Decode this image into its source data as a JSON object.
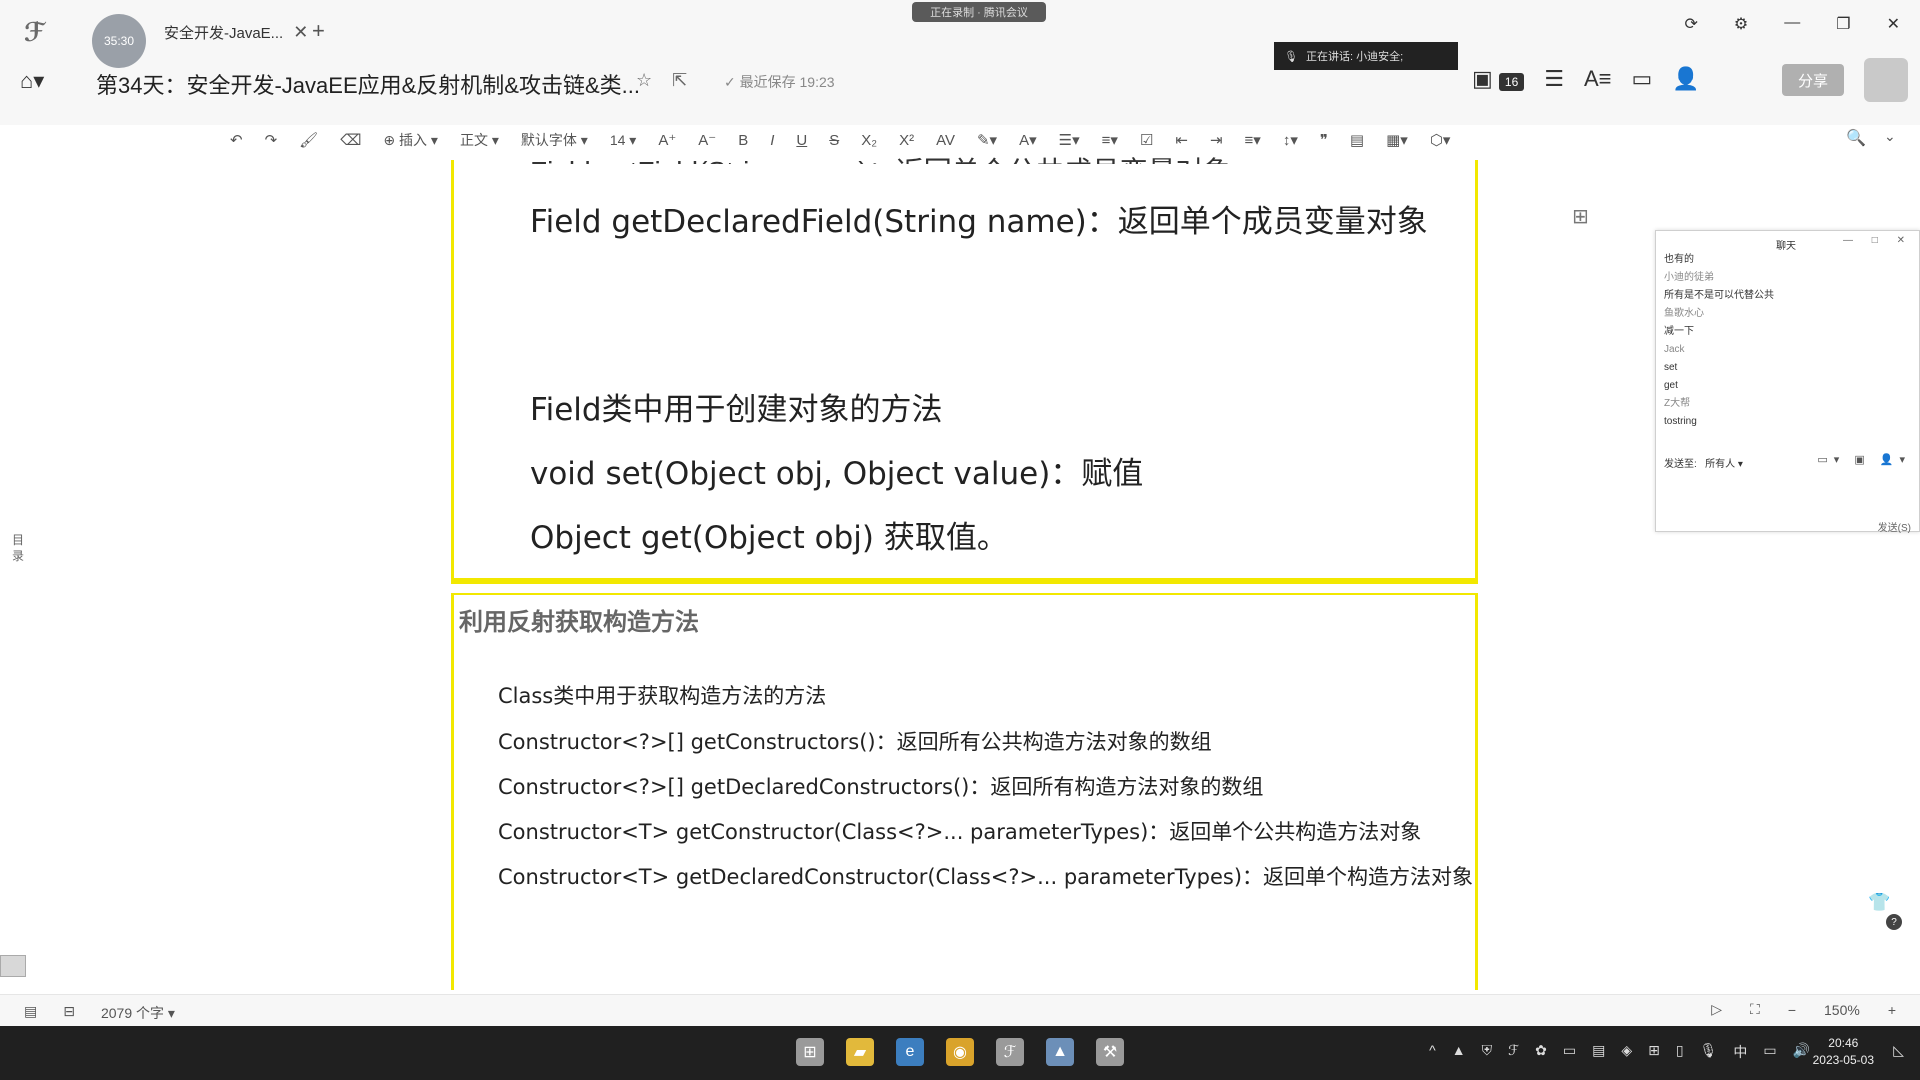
{
  "tab": {
    "timer": "35:30",
    "title": "安全开发-JavaE...",
    "close": "✕",
    "add": "+"
  },
  "header": {
    "doc_title": "第34天：安全开发-JavaEE应用&反射机制&攻击链&类...",
    "last_edit": "最近保存 19:23",
    "recording": "正在录制 · 腾讯会议",
    "speaking": "正在讲话: 小迪安全;",
    "participant_count": "16",
    "share": "分享"
  },
  "toolbar": {
    "insert": "插入",
    "style": "正文",
    "font": "默认字体",
    "size": "14"
  },
  "doc": {
    "cut_line": "Field getField(String name)：返回单个公共成员变量对象",
    "field_declared": "Field getDeclaredField(String name)：返回单个成员变量对象",
    "field_create_heading": "Field类中用于创建对象的方法",
    "set_line": "void set(Object obj, Object value)：赋值",
    "get_line": "Object get(Object obj) 获取值。",
    "section_heading": "利用反射获取构造方法",
    "ctor_heading": "Class类中用于获取构造方法的方法",
    "ctor_lines": [
      "Constructor<?>[] getConstructors()：返回所有公共构造方法对象的数组",
      "Constructor<?>[] getDeclaredConstructors()：返回所有构造方法对象的数组",
      "Constructor<T> getConstructor(Class<?>... parameterTypes)：返回单个公共构造方法对象",
      "Constructor<T> getDeclaredConstructor(Class<?>... parameterTypes)：返回单个构造方法对象"
    ]
  },
  "sidebar": {
    "toc": "目录"
  },
  "chat": {
    "title": "聊天",
    "messages": [
      {
        "text": "也有的",
        "kind": "msg"
      },
      {
        "text": "小迪的徒弟",
        "kind": "name"
      },
      {
        "text": "所有是不是可以代替公共",
        "kind": "msg"
      },
      {
        "text": "鱼歌水心",
        "kind": "name"
      },
      {
        "text": "减一下",
        "kind": "msg"
      },
      {
        "text": "Jack",
        "kind": "name"
      },
      {
        "text": "set",
        "kind": "msg"
      },
      {
        "text": "get",
        "kind": "msg"
      },
      {
        "text": "Z大帮",
        "kind": "name"
      },
      {
        "text": "tostring",
        "kind": "msg"
      }
    ],
    "send_to_label": "发送至:",
    "send_to_value": "所有人",
    "send_button": "发送(S)"
  },
  "status": {
    "word_count": "2079 个字",
    "zoom": "150%"
  },
  "taskbar": {
    "time": "20:46",
    "date": "2023-05-03",
    "ime": "中"
  },
  "colors": {
    "highlight_border": "#f2e800",
    "taskbar": "#202020"
  }
}
